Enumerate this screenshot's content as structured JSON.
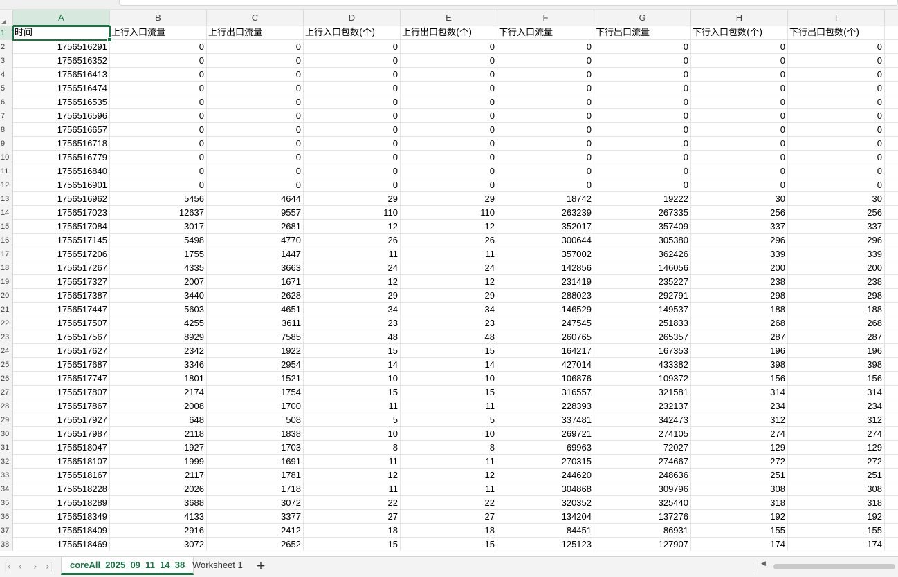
{
  "columns": [
    "A",
    "B",
    "C",
    "D",
    "E",
    "F",
    "G",
    "H",
    "I"
  ],
  "selected_column": "A",
  "header_row": [
    "时间",
    "上行入口流量",
    "上行出口流量",
    "上行入口包数(个)",
    "上行出口包数(个)",
    "下行入口流量",
    "下行出口流量",
    "下行入口包数(个)",
    "下行出口包数(个)"
  ],
  "rows": [
    [
      1756516291,
      0,
      0,
      0,
      0,
      0,
      0,
      0,
      0
    ],
    [
      1756516352,
      0,
      0,
      0,
      0,
      0,
      0,
      0,
      0
    ],
    [
      1756516413,
      0,
      0,
      0,
      0,
      0,
      0,
      0,
      0
    ],
    [
      1756516474,
      0,
      0,
      0,
      0,
      0,
      0,
      0,
      0
    ],
    [
      1756516535,
      0,
      0,
      0,
      0,
      0,
      0,
      0,
      0
    ],
    [
      1756516596,
      0,
      0,
      0,
      0,
      0,
      0,
      0,
      0
    ],
    [
      1756516657,
      0,
      0,
      0,
      0,
      0,
      0,
      0,
      0
    ],
    [
      1756516718,
      0,
      0,
      0,
      0,
      0,
      0,
      0,
      0
    ],
    [
      1756516779,
      0,
      0,
      0,
      0,
      0,
      0,
      0,
      0
    ],
    [
      1756516840,
      0,
      0,
      0,
      0,
      0,
      0,
      0,
      0
    ],
    [
      1756516901,
      0,
      0,
      0,
      0,
      0,
      0,
      0,
      0
    ],
    [
      1756516962,
      5456,
      4644,
      29,
      29,
      18742,
      19222,
      30,
      30
    ],
    [
      1756517023,
      12637,
      9557,
      110,
      110,
      263239,
      267335,
      256,
      256
    ],
    [
      1756517084,
      3017,
      2681,
      12,
      12,
      352017,
      357409,
      337,
      337
    ],
    [
      1756517145,
      5498,
      4770,
      26,
      26,
      300644,
      305380,
      296,
      296
    ],
    [
      1756517206,
      1755,
      1447,
      11,
      11,
      357002,
      362426,
      339,
      339
    ],
    [
      1756517267,
      4335,
      3663,
      24,
      24,
      142856,
      146056,
      200,
      200
    ],
    [
      1756517327,
      2007,
      1671,
      12,
      12,
      231419,
      235227,
      238,
      238
    ],
    [
      1756517387,
      3440,
      2628,
      29,
      29,
      288023,
      292791,
      298,
      298
    ],
    [
      1756517447,
      5603,
      4651,
      34,
      34,
      146529,
      149537,
      188,
      188
    ],
    [
      1756517507,
      4255,
      3611,
      23,
      23,
      247545,
      251833,
      268,
      268
    ],
    [
      1756517567,
      8929,
      7585,
      48,
      48,
      260765,
      265357,
      287,
      287
    ],
    [
      1756517627,
      2342,
      1922,
      15,
      15,
      164217,
      167353,
      196,
      196
    ],
    [
      1756517687,
      3346,
      2954,
      14,
      14,
      427014,
      433382,
      398,
      398
    ],
    [
      1756517747,
      1801,
      1521,
      10,
      10,
      106876,
      109372,
      156,
      156
    ],
    [
      1756517807,
      2174,
      1754,
      15,
      15,
      316557,
      321581,
      314,
      314
    ],
    [
      1756517867,
      2008,
      1700,
      11,
      11,
      228393,
      232137,
      234,
      234
    ],
    [
      1756517927,
      648,
      508,
      5,
      5,
      337481,
      342473,
      312,
      312
    ],
    [
      1756517987,
      2118,
      1838,
      10,
      10,
      269721,
      274105,
      274,
      274
    ],
    [
      1756518047,
      1927,
      1703,
      8,
      8,
      69963,
      72027,
      129,
      129
    ],
    [
      1756518107,
      1999,
      1691,
      11,
      11,
      270315,
      274667,
      272,
      272
    ],
    [
      1756518167,
      2117,
      1781,
      12,
      12,
      244620,
      248636,
      251,
      251
    ],
    [
      1756518228,
      2026,
      1718,
      11,
      11,
      304868,
      309796,
      308,
      308
    ],
    [
      1756518289,
      3688,
      3072,
      22,
      22,
      320352,
      325440,
      318,
      318
    ],
    [
      1756518349,
      4133,
      3377,
      27,
      27,
      134204,
      137276,
      192,
      192
    ],
    [
      1756518409,
      2916,
      2412,
      18,
      18,
      84451,
      86931,
      155,
      155
    ],
    [
      1756518469,
      3072,
      2652,
      15,
      15,
      125123,
      127907,
      174,
      174
    ]
  ],
  "sheet_tabs": {
    "active": "coreAll_2025_09_11_14_38",
    "other": "Worksheet 1",
    "add": "+"
  },
  "nav": {
    "first": "|‹",
    "prev": "‹",
    "next": "›",
    "last": "›|"
  },
  "colors": {
    "accent": "#1e7145",
    "selected_header_bg": "#d7e9df"
  }
}
